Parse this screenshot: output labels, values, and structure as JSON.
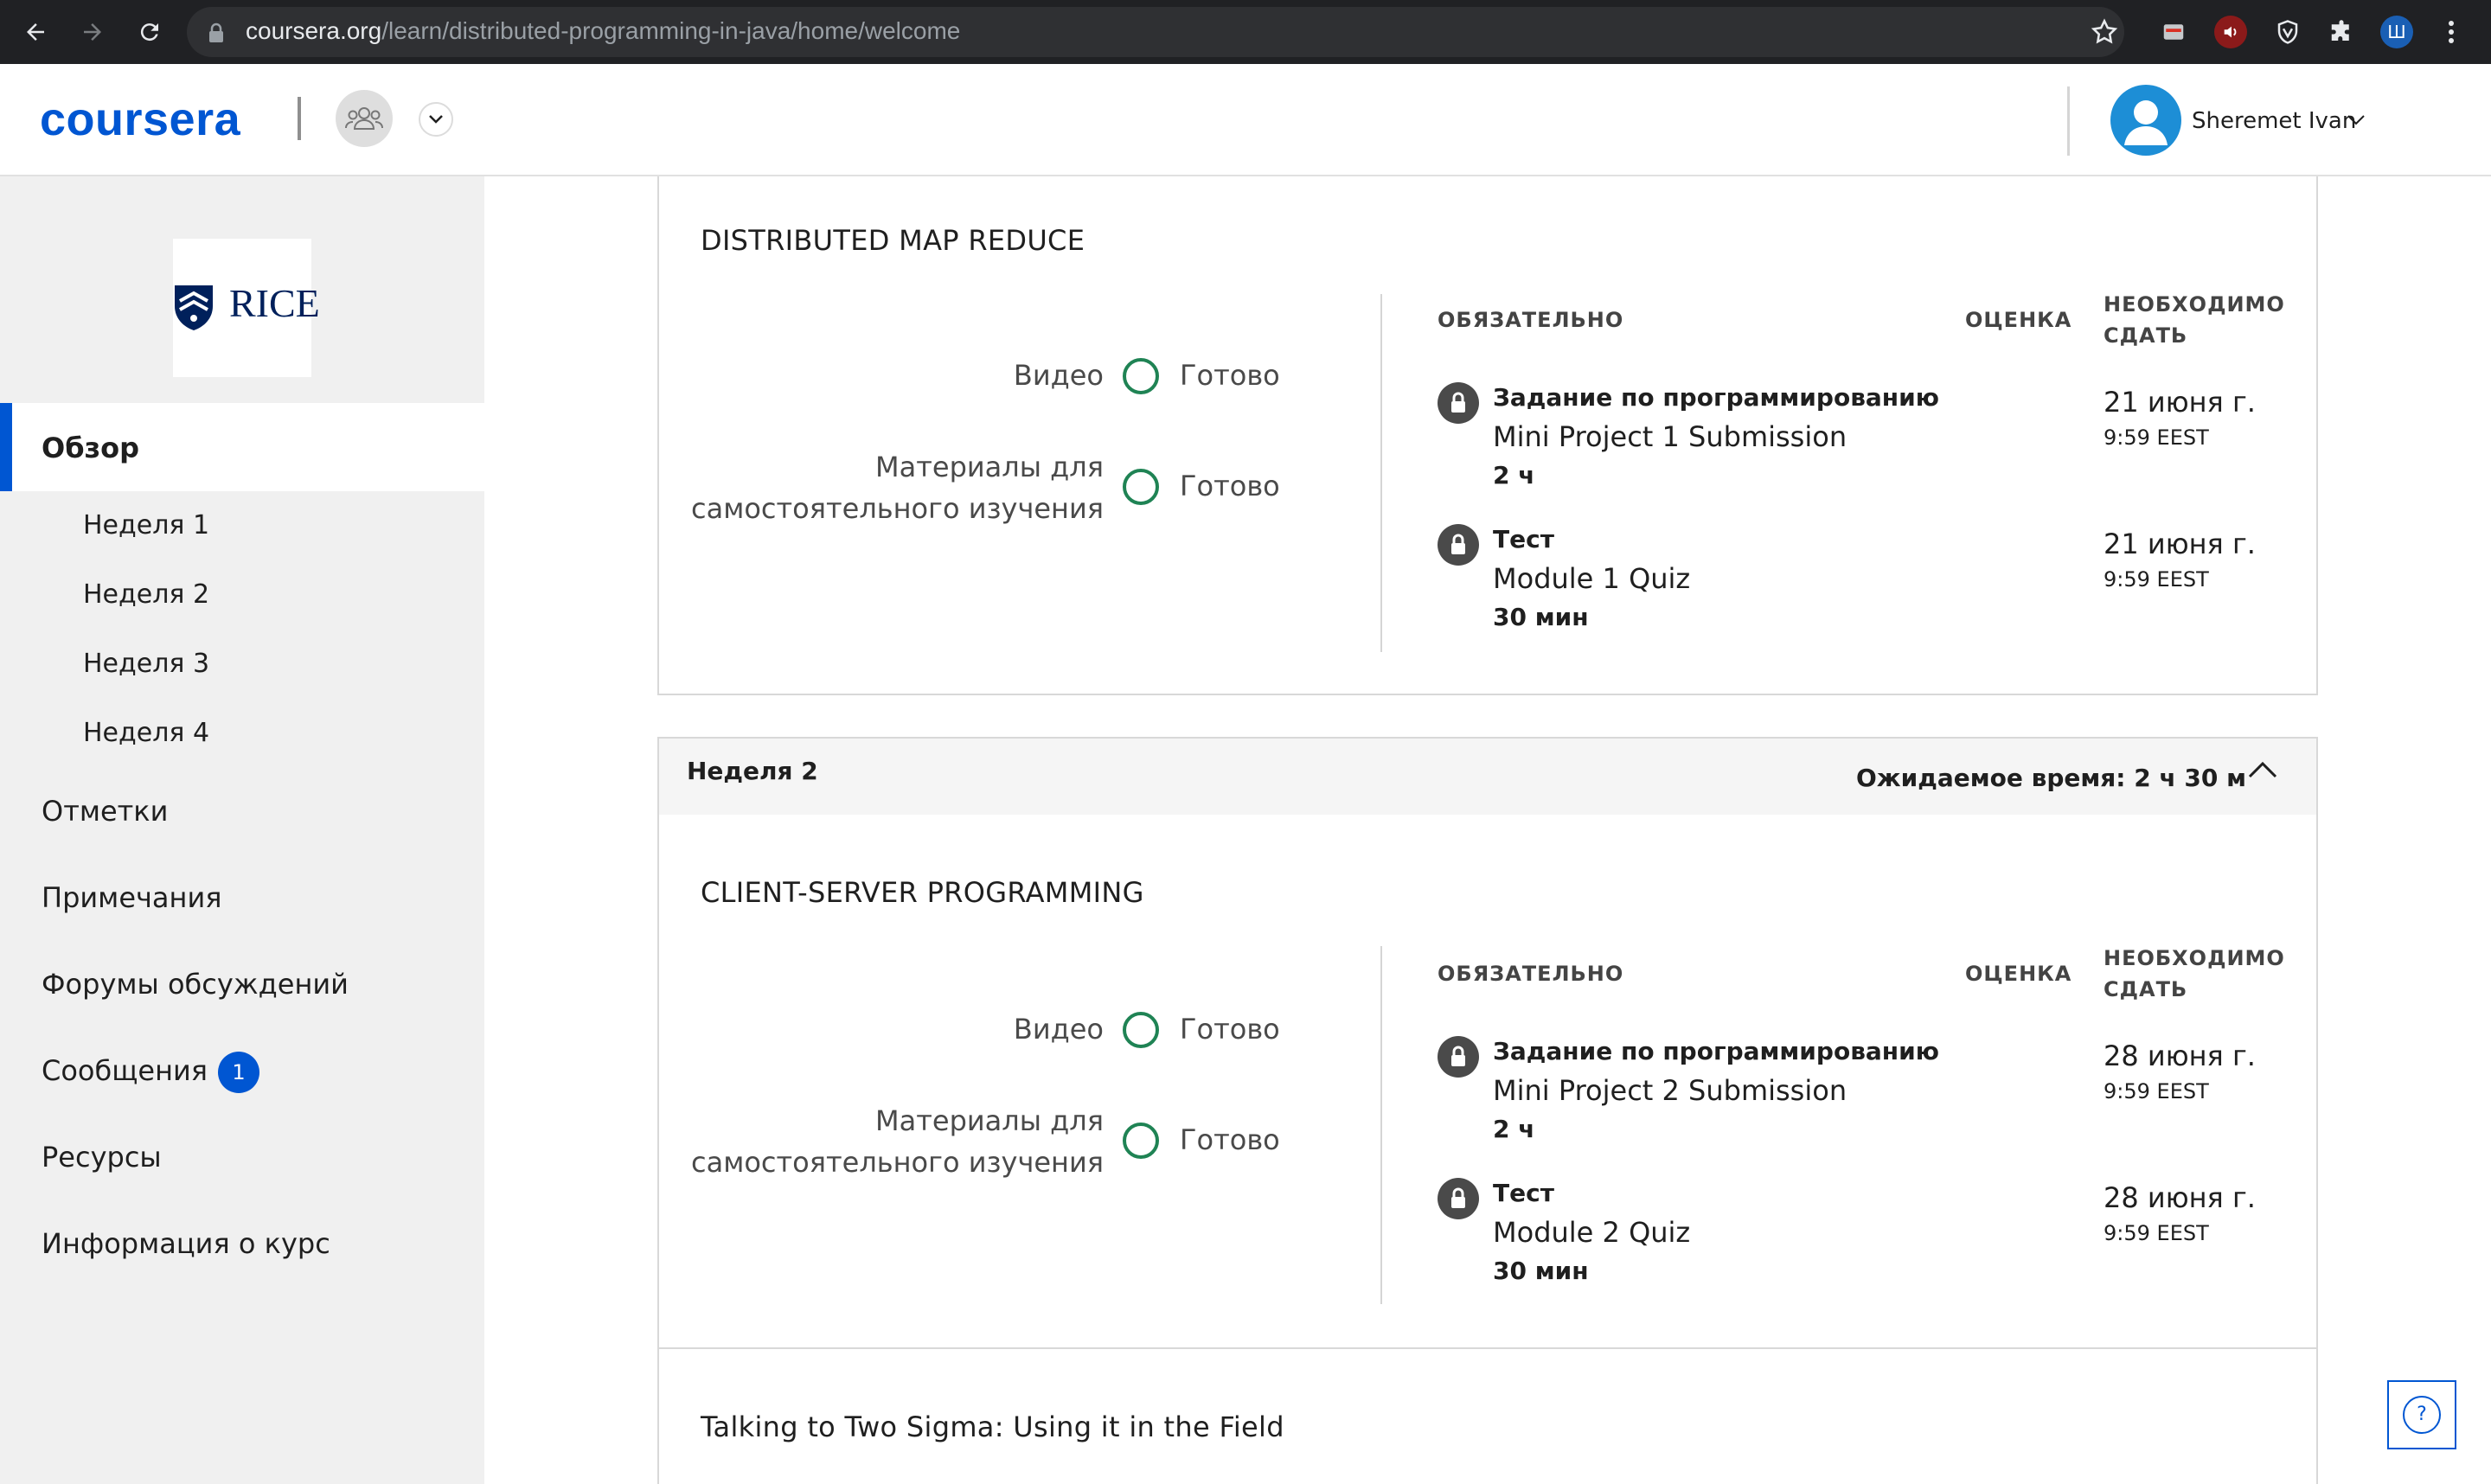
{
  "browser": {
    "url_host": "coursera.org",
    "url_path": "/learn/distributed-programming-in-java/home/welcome",
    "profile_initial": "Ш"
  },
  "header": {
    "logo": "coursera",
    "user_name": "Sheremet Ivan"
  },
  "sidebar": {
    "university_logo": "RICE",
    "overview": "Обзор",
    "weeks": [
      "Неделя 1",
      "Неделя 2",
      "Неделя 3",
      "Неделя 4"
    ],
    "links": [
      "Отметки",
      "Примечания",
      "Форумы обсуждений",
      "Сообщения",
      "Ресурсы",
      "Информация о курс"
    ],
    "messages_badge": "1"
  },
  "table_headers": {
    "required": "ОБЯЗАТЕЛЬНО",
    "grade": "ОЦЕНКА",
    "due_line1": "НЕОБХОДИМО",
    "due_line2": "СДАТЬ"
  },
  "progress_labels": {
    "video": "Видео",
    "reading_line1": "Материалы для",
    "reading_line2": "самостоятельного изучения",
    "ready": "Готово"
  },
  "module1": {
    "title": "DISTRIBUTED MAP REDUCE",
    "items": [
      {
        "type": "Задание по программированию",
        "name": "Mini Project 1 Submission",
        "duration": "2 ч",
        "due_date": "21 июня г.",
        "due_time": "9:59 EEST"
      },
      {
        "type": "Тест",
        "name": "Module 1 Quiz",
        "duration": "30 мин",
        "due_date": "21 июня г.",
        "due_time": "9:59 EEST"
      }
    ]
  },
  "week2": {
    "title": "Неделя 2",
    "expected_time": "Ожидаемое время: 2 ч 30 м"
  },
  "module2": {
    "title": "CLIENT-SERVER PROGRAMMING",
    "items": [
      {
        "type": "Задание по программированию",
        "name": "Mini Project 2 Submission",
        "duration": "2 ч",
        "due_date": "28 июня г.",
        "due_time": "9:59 EEST"
      },
      {
        "type": "Тест",
        "name": "Module 2 Quiz",
        "duration": "30 мин",
        "due_date": "28 июня г.",
        "due_time": "9:59 EEST"
      }
    ]
  },
  "module3": {
    "title": "Talking to Two Sigma: Using it in the Field"
  },
  "help": {
    "label": "?"
  },
  "colors": {
    "brand": "#0056d2",
    "complete_ring": "#1f8354",
    "sidebar_bg": "#f0f0f0",
    "chrome_bg": "#202124"
  }
}
